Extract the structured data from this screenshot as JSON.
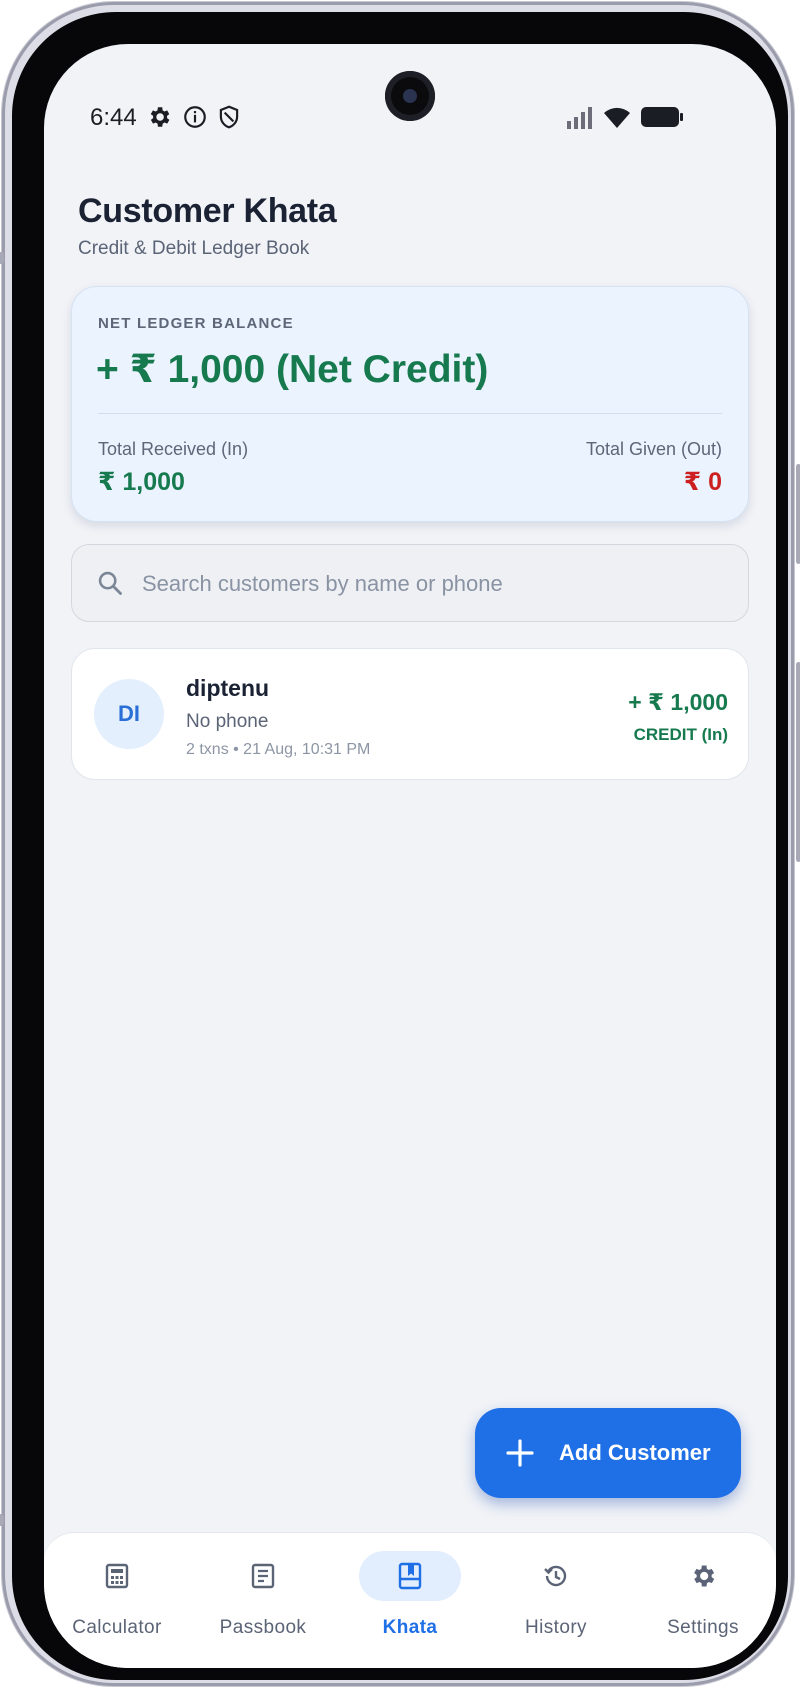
{
  "status_bar": {
    "time": "6:44",
    "left_icons": [
      "settings-gear-icon",
      "info-icon",
      "shield-icon"
    ],
    "right_icons": [
      "signal-icon",
      "wifi-icon",
      "battery-icon"
    ]
  },
  "header": {
    "title": "Customer Khata",
    "subtitle": "Credit & Debit Ledger Book"
  },
  "balance": {
    "label": "NET LEDGER BALANCE",
    "amount": "+ ₹ 1,000 (Net Credit)",
    "received_label": "Total Received (In)",
    "received_value": "₹ 1,000",
    "given_label": "Total Given (Out)",
    "given_value": "₹ 0"
  },
  "search": {
    "placeholder": "Search customers by name or phone",
    "value": ""
  },
  "customers": [
    {
      "initials": "DI",
      "name": "diptenu",
      "phone": "No phone",
      "meta": "2 txns • 21 Aug, 10:31 PM",
      "amount": "+ ₹ 1,000",
      "type": "CREDIT (In)"
    }
  ],
  "fab": {
    "label": "Add Customer"
  },
  "nav": {
    "items": [
      {
        "label": "Calculator",
        "icon": "calculator-icon",
        "active": false
      },
      {
        "label": "Passbook",
        "icon": "passbook-icon",
        "active": false
      },
      {
        "label": "Khata",
        "icon": "khata-book-icon",
        "active": true
      },
      {
        "label": "History",
        "icon": "history-icon",
        "active": false
      },
      {
        "label": "Settings",
        "icon": "settings-icon",
        "active": false
      }
    ]
  },
  "colors": {
    "accent": "#1f6fe6",
    "credit": "#167a4e",
    "debit": "#cc1f1f",
    "background": "#f1f3f7"
  }
}
